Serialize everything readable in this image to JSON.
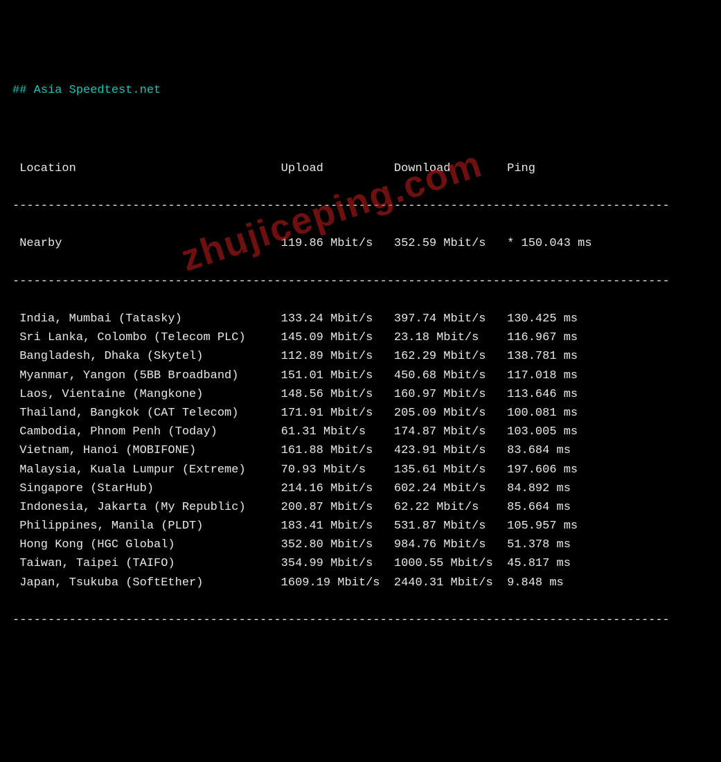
{
  "title": "## Asia Speedtest.net",
  "headers": {
    "location": "Location",
    "upload": "Upload",
    "download": "Download",
    "ping": "Ping"
  },
  "nearby": {
    "location": "Nearby",
    "upload": "119.86 Mbit/s",
    "download": "352.59 Mbit/s",
    "ping": "* 150.043 ms"
  },
  "rows": [
    {
      "location": "India, Mumbai (Tatasky)",
      "upload": "133.24 Mbit/s",
      "download": "397.74 Mbit/s",
      "ping": "130.425 ms"
    },
    {
      "location": "Sri Lanka, Colombo (Telecom PLC)",
      "upload": "145.09 Mbit/s",
      "download": "23.18 Mbit/s",
      "ping": "116.967 ms"
    },
    {
      "location": "Bangladesh, Dhaka (Skytel)",
      "upload": "112.89 Mbit/s",
      "download": "162.29 Mbit/s",
      "ping": "138.781 ms"
    },
    {
      "location": "Myanmar, Yangon (5BB Broadband)",
      "upload": "151.01 Mbit/s",
      "download": "450.68 Mbit/s",
      "ping": "117.018 ms"
    },
    {
      "location": "Laos, Vientaine (Mangkone)",
      "upload": "148.56 Mbit/s",
      "download": "160.97 Mbit/s",
      "ping": "113.646 ms"
    },
    {
      "location": "Thailand, Bangkok (CAT Telecom)",
      "upload": "171.91 Mbit/s",
      "download": "205.09 Mbit/s",
      "ping": "100.081 ms"
    },
    {
      "location": "Cambodia, Phnom Penh (Today)",
      "upload": "61.31 Mbit/s",
      "download": "174.87 Mbit/s",
      "ping": "103.005 ms"
    },
    {
      "location": "Vietnam, Hanoi (MOBIFONE)",
      "upload": "161.88 Mbit/s",
      "download": "423.91 Mbit/s",
      "ping": "83.684 ms"
    },
    {
      "location": "Malaysia, Kuala Lumpur (Extreme)",
      "upload": "70.93 Mbit/s",
      "download": "135.61 Mbit/s",
      "ping": "197.606 ms"
    },
    {
      "location": "Singapore (StarHub)",
      "upload": "214.16 Mbit/s",
      "download": "602.24 Mbit/s",
      "ping": "84.892 ms"
    },
    {
      "location": "Indonesia, Jakarta (My Republic)",
      "upload": "200.87 Mbit/s",
      "download": "62.22 Mbit/s",
      "ping": "85.664 ms"
    },
    {
      "location": "Philippines, Manila (PLDT)",
      "upload": "183.41 Mbit/s",
      "download": "531.87 Mbit/s",
      "ping": "105.957 ms"
    },
    {
      "location": "Hong Kong (HGC Global)",
      "upload": "352.80 Mbit/s",
      "download": "984.76 Mbit/s",
      "ping": "51.378 ms"
    },
    {
      "location": "Taiwan, Taipei (TAIFO)",
      "upload": "354.99 Mbit/s",
      "download": "1000.55 Mbit/s",
      "ping": "45.817 ms"
    },
    {
      "location": "Japan, Tsukuba (SoftEther)",
      "upload": "1609.19 Mbit/s",
      "download": "2440.31 Mbit/s",
      "ping": "9.848 ms"
    }
  ],
  "divider_top": "---------------------------------------------------------------------------------------------",
  "divider_nearby": "---------------------------------------------------------------------------------------------",
  "divider_bottom": "---------------------------------------------------------------------------------------------",
  "watermark": "zhujiceping.com",
  "cols": {
    "location": 37,
    "upload": 16,
    "download": 16
  }
}
